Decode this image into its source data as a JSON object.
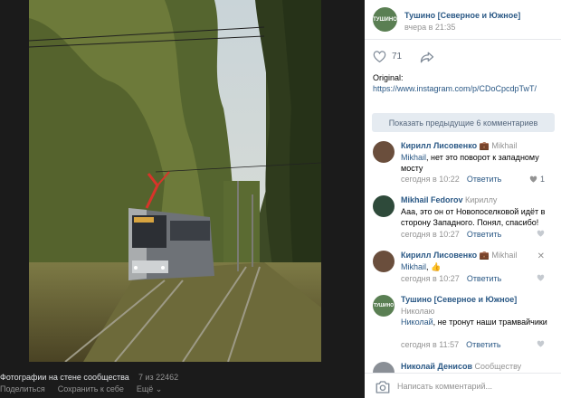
{
  "photo": {
    "caption_title": "Фотографии на стене сообщества",
    "counter": "7 из 22462",
    "actions": {
      "share": "Поделиться",
      "save": "Сохранить к себе",
      "more": "Ещё"
    }
  },
  "post": {
    "group_name": "Тушино [Северное и Южное]",
    "avatar_text": "ТУШИНО",
    "time": "вчера в 21:35",
    "likes": "71",
    "original_label": "Original:",
    "original_link": "https://www.instagram.com/p/CDoCpcdpTwT/",
    "show_previous": "Показать предыдущие 6 комментариев"
  },
  "comments": [
    {
      "author": "Кирилл Лисовенко",
      "reply_to": "Mikhail",
      "mention": "Mikhail",
      "text": ", нет это поворот к западному мосту",
      "time": "сегодня в 10:22",
      "reply": "Ответить",
      "likes": "1"
    },
    {
      "author": "Mikhail Fedorov",
      "reply_to": "Кириллу",
      "text": "Ааа, это он от Новопоселковой идёт в сторону Западного. Понял, спасибо!",
      "time": "сегодня в 10:27",
      "reply": "Ответить"
    },
    {
      "author": "Кирилл Лисовенко",
      "reply_to": "Mikhail",
      "mention": "Mikhail",
      "text": ", 👍",
      "time": "сегодня в 10:27",
      "reply": "Ответить",
      "close": "✕"
    },
    {
      "author": "Тушино [Северное и Южное]",
      "reply_to": "Николаю",
      "mention": "Николай",
      "text": ", не тронут наши трамвайчики",
      "time": "сегодня в 11:57",
      "reply": "Ответить"
    },
    {
      "author": "Николай Денисов",
      "reply_to": "Сообществу"
    }
  ],
  "input": {
    "placeholder": "Написать комментарий..."
  },
  "colors": {
    "link": "#2a5885",
    "meta": "#939393",
    "button_bg": "#e5ebf1"
  }
}
